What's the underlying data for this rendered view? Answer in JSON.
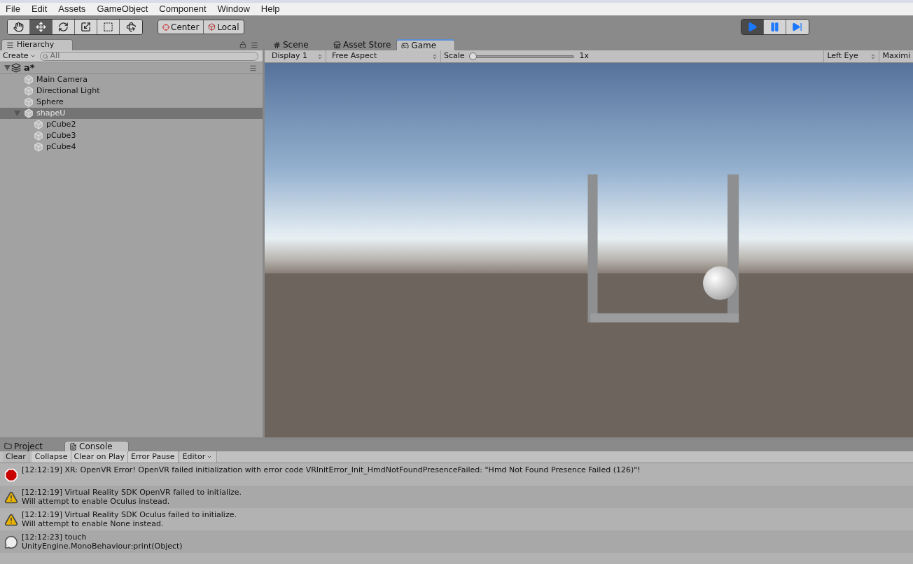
{
  "menu": [
    "File",
    "Edit",
    "Assets",
    "GameObject",
    "Component",
    "Window",
    "Help"
  ],
  "tools": [
    {
      "kind": "hand",
      "selected": false
    },
    {
      "kind": "move",
      "selected": true
    },
    {
      "kind": "rotate",
      "selected": false
    },
    {
      "kind": "scale",
      "selected": false
    },
    {
      "kind": "rect",
      "selected": false
    },
    {
      "kind": "transform",
      "selected": false
    }
  ],
  "pivot_buttons": [
    {
      "kind": "pivot",
      "label": "Center"
    },
    {
      "kind": "space",
      "label": "Local"
    }
  ],
  "playback": [
    {
      "kind": "play",
      "selected": true
    },
    {
      "kind": "pause",
      "selected": false
    },
    {
      "kind": "step",
      "selected": false
    }
  ],
  "hierarchy": {
    "tab": "Hierarchy",
    "create": "Create",
    "search_placeholder": "All",
    "tree": [
      {
        "label": "a*",
        "kind": "scene",
        "expanded": true,
        "selected": false,
        "children": [
          {
            "label": "Main Camera",
            "kind": "object",
            "selected": false
          },
          {
            "label": "Directional Light",
            "kind": "object",
            "selected": false
          },
          {
            "label": "Sphere",
            "kind": "object",
            "selected": false
          },
          {
            "label": "shapeU",
            "kind": "object",
            "selected": true,
            "expanded": true,
            "children": [
              {
                "label": "pCube2",
                "kind": "object",
                "selected": false
              },
              {
                "label": "pCube3",
                "kind": "object",
                "selected": false
              },
              {
                "label": "pCube4",
                "kind": "object",
                "selected": false
              }
            ]
          }
        ]
      }
    ]
  },
  "view_tabs": [
    {
      "label": "Scene",
      "kind": "scene",
      "selected": false
    },
    {
      "label": "Asset Store",
      "kind": "store",
      "selected": false
    },
    {
      "label": "Game",
      "kind": "game",
      "selected": true
    }
  ],
  "game_toolbar": {
    "display": "Display 1",
    "aspect": "Free Aspect",
    "scale_label": "Scale",
    "scale": {
      "level": 0,
      "reading": "1x"
    },
    "eye": "Left Eye",
    "maximize": "Maximi"
  },
  "bottom_tabs": [
    {
      "label": "Project",
      "kind": "project",
      "selected": false
    },
    {
      "label": "Console",
      "kind": "console",
      "selected": true
    }
  ],
  "console_buttons": [
    {
      "label": "Clear",
      "kind": "button"
    },
    {
      "label": "Collapse",
      "kind": "toggle"
    },
    {
      "label": "Clear on Play",
      "kind": "toggle"
    },
    {
      "label": "Error Pause",
      "kind": "toggle"
    },
    {
      "label": "Editor",
      "kind": "dropdown"
    }
  ],
  "logs": [
    {
      "kind": "error",
      "lines": [
        "[12:12:19] XR: OpenVR Error! OpenVR failed initialization with error code VRInitError_Init_HmdNotFoundPresenceFailed: \"Hmd Not Found Presence Failed (126)\"!"
      ]
    },
    {
      "kind": "warning",
      "lines": [
        "[12:12:19] Virtual Reality SDK OpenVR failed to initialize.",
        "Will attempt to enable Oculus instead."
      ]
    },
    {
      "kind": "warning",
      "lines": [
        "[12:12:19] Virtual Reality SDK Oculus failed to initialize.",
        "Will attempt to enable None instead."
      ]
    },
    {
      "kind": "info",
      "lines": [
        "[12:12:23] touch",
        "UnityEngine.MonoBehaviour:print(Object)"
      ]
    }
  ]
}
